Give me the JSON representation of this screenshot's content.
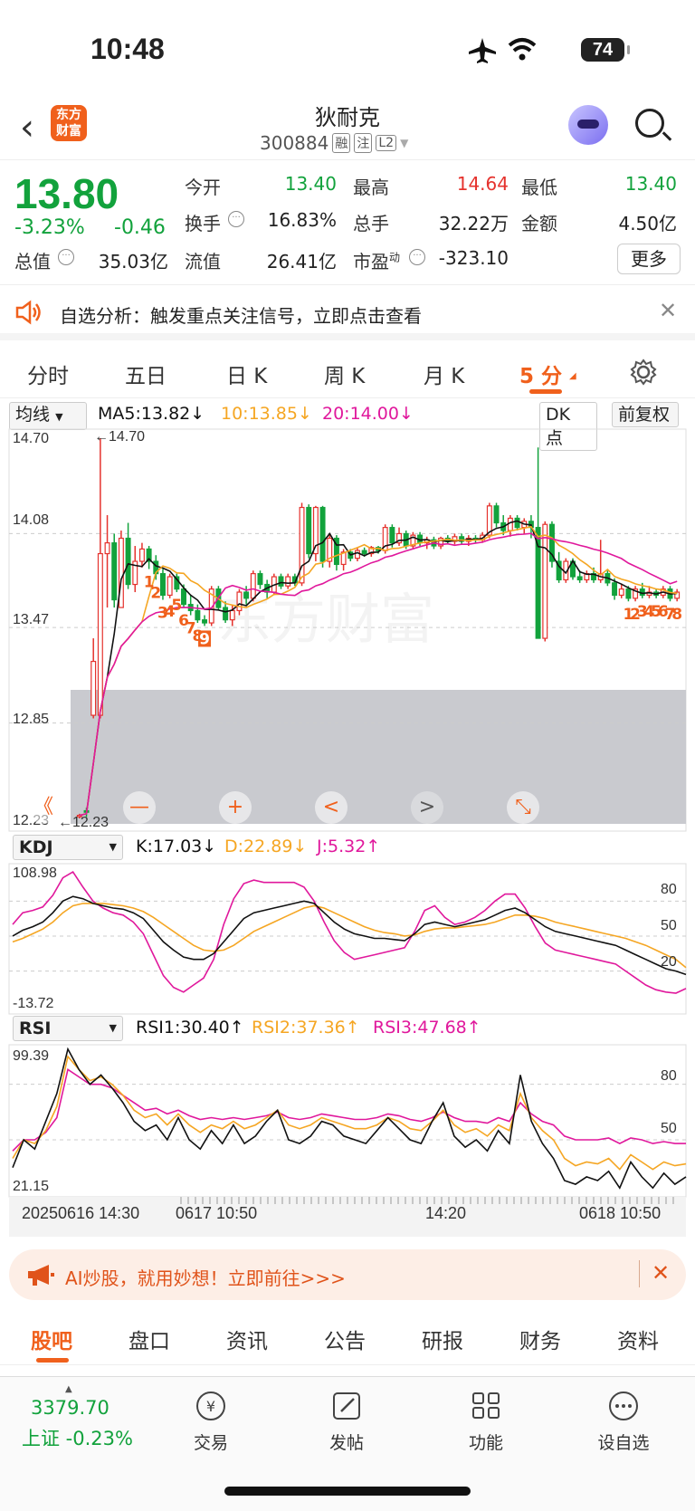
{
  "status_bar": {
    "time": "10:48",
    "battery": "74"
  },
  "header": {
    "app_logo_text": "东方\n财富",
    "stock_name": "狄耐克",
    "stock_code": "300884",
    "tags": [
      "融",
      "注",
      "L2"
    ]
  },
  "quote": {
    "price": "13.80",
    "change_pct": "-3.23%",
    "change_abs": "-0.46",
    "total_value_label": "总值",
    "total_value": "35.03亿",
    "open_label": "今开",
    "open": "13.40",
    "high_label": "最高",
    "high": "14.64",
    "low_label": "最低",
    "low": "13.40",
    "turnover_label": "换手",
    "turnover": "16.83%",
    "volume_label": "总手",
    "volume": "32.22万",
    "amount_label": "金额",
    "amount": "4.50亿",
    "float_label": "流值",
    "float_value": "26.41亿",
    "pe_label": "市盈",
    "pe_sup": "动",
    "pe": "-323.10",
    "more_label": "更多"
  },
  "notice": {
    "text": "自选分析：触发重点关注信号，立即点击查看"
  },
  "tabs": [
    "分时",
    "五日",
    "日 K",
    "周 K",
    "月 K",
    "5 分"
  ],
  "active_tab": "5 分",
  "indicators": {
    "ma_selector": "均线",
    "ma5": "MA5:13.82",
    "ma10": "10:13.85",
    "ma20": "20:14.00",
    "dk_label": "DK 点",
    "adjust_label": "前复权",
    "kdj_selector": "KDJ",
    "kdj_k": "K:17.03",
    "kdj_d": "D:22.89",
    "kdj_j": "J:5.32",
    "rsi_selector": "RSI",
    "rsi1": "RSI1:30.40",
    "rsi2": "RSI2:37.36",
    "rsi3": "RSI3:47.68",
    "arrow_down": "↓",
    "arrow_up": "↑"
  },
  "colors": {
    "up": "#e5322d",
    "down": "#12a23c",
    "ma5": "#111111",
    "ma10": "#f5a623",
    "ma20": "#e0189c",
    "accent": "#f0601c"
  },
  "chart_data": {
    "type": "candlestick",
    "ylim": [
      12.23,
      14.7
    ],
    "y_ticks": [
      "14.70",
      "14.08",
      "13.47",
      "12.85",
      "12.23"
    ],
    "high_marker": "←14.70",
    "low_marker": "←12.23",
    "watermark": "东方财富",
    "td_counts_left": [
      "1",
      "2",
      "3",
      "4",
      "5",
      "6",
      "7",
      "8",
      "9"
    ],
    "td_counts_right": [
      "1",
      "2",
      "3",
      "4",
      "5",
      "6",
      "7",
      "8"
    ],
    "candles": [
      {
        "o": 12.25,
        "c": 12.25,
        "h": 12.26,
        "l": 12.23
      },
      {
        "o": 12.28,
        "c": 12.27,
        "h": 12.3,
        "l": 12.24
      },
      {
        "o": 12.9,
        "c": 13.25,
        "h": 13.4,
        "l": 12.88
      },
      {
        "o": 12.9,
        "c": 13.95,
        "h": 14.7,
        "l": 12.88
      },
      {
        "o": 13.95,
        "c": 14.02,
        "h": 14.2,
        "l": 13.6
      },
      {
        "o": 14.02,
        "c": 13.65,
        "h": 14.08,
        "l": 13.6
      },
      {
        "o": 13.6,
        "c": 14.05,
        "h": 14.1,
        "l": 13.6
      },
      {
        "o": 14.05,
        "c": 13.75,
        "h": 14.15,
        "l": 13.72
      },
      {
        "o": 13.75,
        "c": 13.9,
        "h": 14.0,
        "l": 13.7
      },
      {
        "o": 13.9,
        "c": 13.98,
        "h": 14.02,
        "l": 13.86
      },
      {
        "o": 13.98,
        "c": 13.9,
        "h": 14.0,
        "l": 13.85
      },
      {
        "o": 13.9,
        "c": 13.82,
        "h": 13.94,
        "l": 13.78
      },
      {
        "o": 13.82,
        "c": 13.68,
        "h": 13.85,
        "l": 13.65
      },
      {
        "o": 13.68,
        "c": 13.8,
        "h": 13.82,
        "l": 13.66
      },
      {
        "o": 13.8,
        "c": 13.72,
        "h": 13.82,
        "l": 13.7
      },
      {
        "o": 13.72,
        "c": 13.62,
        "h": 13.75,
        "l": 13.6
      },
      {
        "o": 13.62,
        "c": 13.58,
        "h": 13.68,
        "l": 13.55
      },
      {
        "o": 13.58,
        "c": 13.52,
        "h": 13.62,
        "l": 13.5
      },
      {
        "o": 13.52,
        "c": 13.5,
        "h": 13.55,
        "l": 13.48
      },
      {
        "o": 13.5,
        "c": 13.72,
        "h": 13.74,
        "l": 13.48
      },
      {
        "o": 13.72,
        "c": 13.6,
        "h": 13.74,
        "l": 13.58
      },
      {
        "o": 13.6,
        "c": 13.52,
        "h": 13.64,
        "l": 13.5
      },
      {
        "o": 13.52,
        "c": 13.58,
        "h": 13.62,
        "l": 13.48
      },
      {
        "o": 13.58,
        "c": 13.7,
        "h": 13.72,
        "l": 13.55
      },
      {
        "o": 13.7,
        "c": 13.66,
        "h": 13.74,
        "l": 13.62
      },
      {
        "o": 13.66,
        "c": 13.82,
        "h": 13.84,
        "l": 13.64
      },
      {
        "o": 13.82,
        "c": 13.75,
        "h": 13.84,
        "l": 13.72
      },
      {
        "o": 13.75,
        "c": 13.7,
        "h": 13.78,
        "l": 13.66
      },
      {
        "o": 13.7,
        "c": 13.8,
        "h": 13.82,
        "l": 13.68
      },
      {
        "o": 13.8,
        "c": 13.74,
        "h": 13.82,
        "l": 13.72
      },
      {
        "o": 13.74,
        "c": 13.8,
        "h": 13.82,
        "l": 13.72
      },
      {
        "o": 13.8,
        "c": 13.76,
        "h": 13.82,
        "l": 13.74
      },
      {
        "o": 13.76,
        "c": 14.25,
        "h": 14.28,
        "l": 13.74
      },
      {
        "o": 14.25,
        "c": 13.95,
        "h": 14.27,
        "l": 13.92
      },
      {
        "o": 13.95,
        "c": 14.25,
        "h": 14.26,
        "l": 13.9
      },
      {
        "o": 14.25,
        "c": 13.9,
        "h": 14.26,
        "l": 13.86
      },
      {
        "o": 13.9,
        "c": 14.05,
        "h": 14.08,
        "l": 13.86
      },
      {
        "o": 14.05,
        "c": 13.88,
        "h": 14.07,
        "l": 13.84
      },
      {
        "o": 13.88,
        "c": 13.96,
        "h": 13.98,
        "l": 13.84
      },
      {
        "o": 13.96,
        "c": 13.92,
        "h": 13.98,
        "l": 13.9
      },
      {
        "o": 13.92,
        "c": 13.97,
        "h": 13.99,
        "l": 13.9
      },
      {
        "o": 13.97,
        "c": 13.95,
        "h": 13.99,
        "l": 13.93
      },
      {
        "o": 13.95,
        "c": 13.99,
        "h": 14.0,
        "l": 13.93
      },
      {
        "o": 13.99,
        "c": 13.97,
        "h": 14.0,
        "l": 13.95
      },
      {
        "o": 13.97,
        "c": 14.12,
        "h": 14.14,
        "l": 13.95
      },
      {
        "o": 14.12,
        "c": 14.02,
        "h": 14.14,
        "l": 13.99
      },
      {
        "o": 14.02,
        "c": 14.08,
        "h": 14.12,
        "l": 14.0
      },
      {
        "o": 14.08,
        "c": 14.0,
        "h": 14.1,
        "l": 13.98
      },
      {
        "o": 14.0,
        "c": 14.07,
        "h": 14.09,
        "l": 13.98
      },
      {
        "o": 14.07,
        "c": 14.02,
        "h": 14.09,
        "l": 14.0
      },
      {
        "o": 14.02,
        "c": 14.04,
        "h": 14.06,
        "l": 13.98
      },
      {
        "o": 14.04,
        "c": 14.0,
        "h": 14.06,
        "l": 13.98
      },
      {
        "o": 14.0,
        "c": 14.05,
        "h": 14.06,
        "l": 13.98
      },
      {
        "o": 14.05,
        "c": 14.03,
        "h": 14.07,
        "l": 14.01
      },
      {
        "o": 14.03,
        "c": 14.06,
        "h": 14.08,
        "l": 14.01
      },
      {
        "o": 14.06,
        "c": 14.03,
        "h": 14.08,
        "l": 14.01
      },
      {
        "o": 14.03,
        "c": 14.05,
        "h": 14.07,
        "l": 14.0
      },
      {
        "o": 14.05,
        "c": 14.04,
        "h": 14.07,
        "l": 14.02
      },
      {
        "o": 14.04,
        "c": 14.07,
        "h": 14.09,
        "l": 14.02
      },
      {
        "o": 14.07,
        "c": 14.26,
        "h": 14.28,
        "l": 14.05
      },
      {
        "o": 14.26,
        "c": 14.15,
        "h": 14.28,
        "l": 14.12
      },
      {
        "o": 14.15,
        "c": 14.1,
        "h": 14.2,
        "l": 14.07
      },
      {
        "o": 14.1,
        "c": 14.18,
        "h": 14.2,
        "l": 14.06
      },
      {
        "o": 14.18,
        "c": 14.12,
        "h": 14.2,
        "l": 14.1
      },
      {
        "o": 14.12,
        "c": 14.16,
        "h": 14.18,
        "l": 14.08
      },
      {
        "o": 14.16,
        "c": 14.12,
        "h": 14.2,
        "l": 14.05
      },
      {
        "o": 14.12,
        "c": 13.4,
        "h": 14.64,
        "l": 13.4
      },
      {
        "o": 13.4,
        "c": 14.14,
        "h": 14.16,
        "l": 13.38
      },
      {
        "o": 14.14,
        "c": 13.9,
        "h": 14.16,
        "l": 13.86
      },
      {
        "o": 13.9,
        "c": 13.78,
        "h": 13.96,
        "l": 13.76
      },
      {
        "o": 13.78,
        "c": 13.9,
        "h": 13.92,
        "l": 13.76
      },
      {
        "o": 13.9,
        "c": 13.8,
        "h": 13.92,
        "l": 13.78
      },
      {
        "o": 13.8,
        "c": 13.78,
        "h": 13.84,
        "l": 13.76
      },
      {
        "o": 13.78,
        "c": 13.82,
        "h": 13.84,
        "l": 13.76
      },
      {
        "o": 13.82,
        "c": 13.78,
        "h": 13.86,
        "l": 13.76
      },
      {
        "o": 13.78,
        "c": 13.82,
        "h": 14.04,
        "l": 13.76
      },
      {
        "o": 13.82,
        "c": 13.76,
        "h": 13.84,
        "l": 13.74
      },
      {
        "o": 13.76,
        "c": 13.68,
        "h": 13.79,
        "l": 13.65
      },
      {
        "o": 13.68,
        "c": 13.72,
        "h": 13.75,
        "l": 13.66
      },
      {
        "o": 13.72,
        "c": 13.66,
        "h": 13.74,
        "l": 13.64
      },
      {
        "o": 13.66,
        "c": 13.72,
        "h": 13.74,
        "l": 13.64
      },
      {
        "o": 13.72,
        "c": 13.68,
        "h": 13.76,
        "l": 13.66
      },
      {
        "o": 13.68,
        "c": 13.7,
        "h": 13.74,
        "l": 13.66
      },
      {
        "o": 13.7,
        "c": 13.68,
        "h": 13.72,
        "l": 13.66
      },
      {
        "o": 13.68,
        "c": 13.72,
        "h": 13.74,
        "l": 13.66
      },
      {
        "o": 13.72,
        "c": 13.66,
        "h": 13.74,
        "l": 13.64
      },
      {
        "o": 13.66,
        "c": 13.7,
        "h": 13.72,
        "l": 13.64
      }
    ],
    "kdj": {
      "y_ticks": [
        "108.98",
        "-13.72"
      ],
      "right_ticks": [
        "80",
        "50",
        "20"
      ],
      "k": [
        50,
        55,
        58,
        62,
        70,
        80,
        84,
        82,
        78,
        76,
        74,
        73,
        70,
        65,
        55,
        45,
        38,
        32,
        30,
        30,
        35,
        45,
        55,
        65,
        70,
        72,
        74,
        76,
        78,
        80,
        78,
        70,
        62,
        56,
        52,
        50,
        48,
        48,
        47,
        46,
        52,
        60,
        62,
        60,
        58,
        60,
        62,
        64,
        68,
        72,
        74,
        70,
        64,
        58,
        54,
        52,
        50,
        48,
        46,
        44,
        42,
        38,
        34,
        30,
        26,
        22,
        20,
        17
      ],
      "d": [
        45,
        48,
        52,
        56,
        62,
        70,
        76,
        78,
        78,
        78,
        77,
        76,
        74,
        71,
        66,
        60,
        54,
        48,
        42,
        38,
        37,
        38,
        42,
        48,
        54,
        58,
        62,
        66,
        70,
        74,
        76,
        74,
        70,
        66,
        62,
        58,
        55,
        53,
        52,
        50,
        51,
        54,
        56,
        57,
        57,
        58,
        59,
        60,
        62,
        65,
        68,
        68,
        67,
        65,
        62,
        60,
        58,
        56,
        54,
        52,
        50,
        48,
        45,
        42,
        38,
        34,
        30,
        23
      ],
      "j": [
        60,
        70,
        72,
        75,
        85,
        100,
        105,
        92,
        80,
        74,
        70,
        68,
        62,
        52,
        34,
        16,
        6,
        2,
        8,
        14,
        30,
        60,
        82,
        95,
        98,
        96,
        96,
        96,
        96,
        92,
        80,
        62,
        46,
        36,
        30,
        32,
        34,
        36,
        38,
        40,
        54,
        72,
        76,
        66,
        60,
        62,
        66,
        72,
        80,
        86,
        86,
        74,
        58,
        44,
        38,
        36,
        34,
        32,
        30,
        28,
        26,
        20,
        14,
        8,
        4,
        2,
        1,
        5
      ]
    },
    "rsi": {
      "y_ticks": [
        "99.39",
        "21.15"
      ],
      "right_ticks": [
        "80",
        "50"
      ],
      "rsi1": [
        35,
        50,
        45,
        60,
        75,
        99,
        88,
        80,
        85,
        78,
        70,
        60,
        55,
        58,
        50,
        62,
        50,
        45,
        55,
        48,
        58,
        48,
        52,
        60,
        66,
        50,
        48,
        52,
        60,
        58,
        52,
        50,
        48,
        55,
        62,
        56,
        50,
        48,
        60,
        70,
        52,
        46,
        50,
        44,
        55,
        48,
        85,
        60,
        48,
        40,
        28,
        26,
        30,
        28,
        33,
        24,
        38,
        30,
        24,
        32,
        26,
        30
      ],
      "rsi2": [
        40,
        50,
        48,
        55,
        68,
        95,
        88,
        82,
        84,
        80,
        74,
        66,
        62,
        64,
        58,
        64,
        58,
        54,
        58,
        56,
        60,
        56,
        58,
        62,
        66,
        58,
        56,
        58,
        62,
        60,
        58,
        56,
        56,
        58,
        62,
        60,
        56,
        55,
        60,
        66,
        58,
        54,
        56,
        52,
        58,
        55,
        75,
        62,
        55,
        50,
        40,
        36,
        38,
        37,
        40,
        34,
        42,
        38,
        34,
        38,
        36,
        37
      ],
      "rsi3": [
        44,
        50,
        50,
        54,
        62,
        88,
        84,
        80,
        80,
        78,
        74,
        70,
        66,
        67,
        64,
        66,
        63,
        61,
        62,
        61,
        62,
        61,
        62,
        63,
        65,
        62,
        61,
        62,
        64,
        63,
        62,
        61,
        61,
        62,
        64,
        63,
        61,
        60,
        62,
        65,
        62,
        60,
        60,
        59,
        62,
        60,
        70,
        64,
        60,
        58,
        52,
        50,
        50,
        50,
        51,
        48,
        51,
        50,
        48,
        49,
        48,
        48
      ]
    },
    "x_labels": [
      "20250616 14:30",
      "0617 10:50",
      "14:20",
      "0618 10:50"
    ]
  },
  "chart_controls": [
    "《",
    "—",
    "+",
    "<",
    ">",
    "⤡"
  ],
  "ai_banner": {
    "text": "AI炒股，就用妙想！立即前往>>>"
  },
  "bottom_tabs": [
    "股吧",
    "盘口",
    "资讯",
    "公告",
    "研报",
    "财务",
    "资料"
  ],
  "bottom_bar": {
    "index_value": "3379.70",
    "index_label": "上证 -0.23%",
    "items": [
      {
        "label": "交易",
        "icon": "yen-circle-icon"
      },
      {
        "label": "发帖",
        "icon": "edit-icon"
      },
      {
        "label": "功能",
        "icon": "grid-icon"
      },
      {
        "label": "设自选",
        "icon": "more-circle-icon"
      }
    ]
  }
}
